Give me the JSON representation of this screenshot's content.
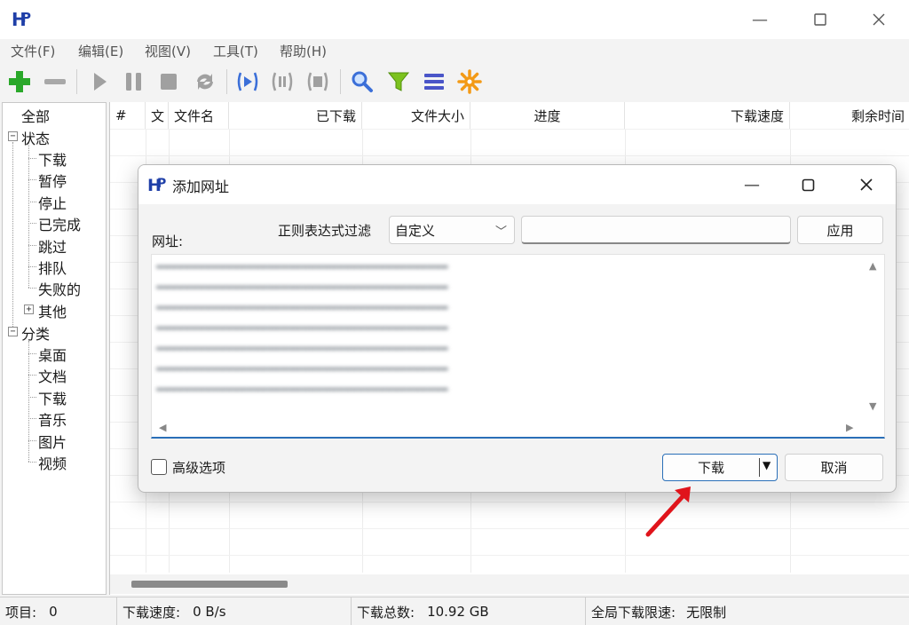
{
  "app": {
    "logo_text": "HP"
  },
  "menubar": {
    "items": [
      {
        "label": "文件(F)"
      },
      {
        "label": "编辑(E)"
      },
      {
        "label": "视图(V)"
      },
      {
        "label": "工具(T)"
      },
      {
        "label": "帮助(H)"
      }
    ]
  },
  "toolbar": {
    "icons": [
      "add-icon",
      "remove-icon",
      "start-icon",
      "pause-icon",
      "stop-icon",
      "refresh-icon",
      "start-all-icon",
      "pause-all-icon",
      "stop-all-icon",
      "search-icon",
      "filter-icon",
      "list-icon",
      "settings-icon"
    ],
    "colors": {
      "add": "#2aa82a",
      "disabled": "#a0a0a0",
      "blue": "#3b6fd8",
      "filter": "#7cc21e",
      "orange": "#f39a16"
    }
  },
  "sidebar": {
    "all": "全部",
    "status": "状态",
    "status_items": [
      "下载",
      "暂停",
      "停止",
      "已完成",
      "跳过",
      "排队",
      "失败的"
    ],
    "other": "其他",
    "category": "分类",
    "category_items": [
      "桌面",
      "文档",
      "下载",
      "音乐",
      "图片",
      "视频"
    ]
  },
  "table": {
    "columns": [
      "#",
      "文",
      "文件名",
      "已下载",
      "文件大小",
      "进度",
      "下载速度",
      "剩余时间"
    ]
  },
  "statusbar": {
    "items_label": "项目:",
    "items_value": "0",
    "speed_label": "下载速度:",
    "speed_value": "0 B/s",
    "total_label": "下载总数:",
    "total_value": "10.92 GB",
    "limit_label": "全局下载限速:",
    "limit_value": "无限制"
  },
  "dialog": {
    "title": "添加网址",
    "url_label": "网址:",
    "filter_label": "正则表达式过滤",
    "filter_selected": "自定义",
    "filter_input_value": "",
    "apply_label": "应用",
    "advanced_label": "高级选项",
    "download_label": "下载",
    "cancel_label": "取消",
    "accent": "#2a6fb8"
  }
}
